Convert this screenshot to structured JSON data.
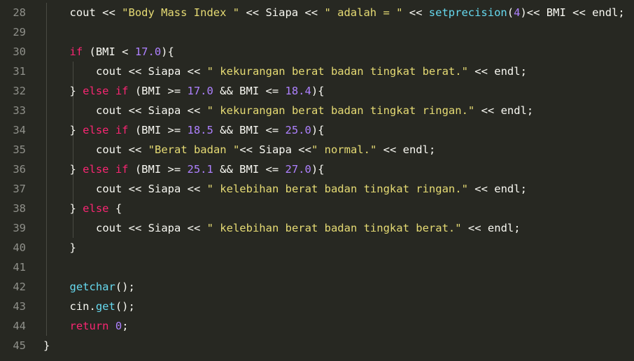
{
  "editor": {
    "theme_colors": {
      "background": "#272822",
      "line_number": "#8f908a",
      "plain": "#f8f8f2",
      "keyword": "#f92672",
      "string": "#e6db74",
      "number": "#ae81ff",
      "function": "#66d9ef"
    },
    "lines": [
      {
        "num": "28",
        "indent": 1,
        "tokens": [
          [
            "plain",
            "cout << "
          ],
          [
            "str",
            "\"Body Mass Index \""
          ],
          [
            "plain",
            " << Siapa << "
          ],
          [
            "str",
            "\" adalah = \""
          ],
          [
            "plain",
            " << "
          ],
          [
            "fn",
            "setprecision"
          ],
          [
            "plain",
            "("
          ],
          [
            "num",
            "4"
          ],
          [
            "plain",
            ")<< BMI << endl;"
          ]
        ]
      },
      {
        "num": "29",
        "indent": 0,
        "tokens": []
      },
      {
        "num": "30",
        "indent": 1,
        "tokens": [
          [
            "kw",
            "if"
          ],
          [
            "plain",
            " (BMI < "
          ],
          [
            "num",
            "17.0"
          ],
          [
            "plain",
            "){"
          ]
        ]
      },
      {
        "num": "31",
        "indent": 2,
        "tokens": [
          [
            "plain",
            "cout << Siapa << "
          ],
          [
            "str",
            "\" kekurangan berat badan tingkat berat.\""
          ],
          [
            "plain",
            " << endl;"
          ]
        ]
      },
      {
        "num": "32",
        "indent": 1,
        "tokens": [
          [
            "plain",
            "} "
          ],
          [
            "kw",
            "else if"
          ],
          [
            "plain",
            " (BMI >= "
          ],
          [
            "num",
            "17.0"
          ],
          [
            "plain",
            " && BMI <= "
          ],
          [
            "num",
            "18.4"
          ],
          [
            "plain",
            "){"
          ]
        ]
      },
      {
        "num": "33",
        "indent": 2,
        "tokens": [
          [
            "plain",
            "cout << Siapa << "
          ],
          [
            "str",
            "\" kekurangan berat badan tingkat ringan.\""
          ],
          [
            "plain",
            " << endl;"
          ]
        ]
      },
      {
        "num": "34",
        "indent": 1,
        "tokens": [
          [
            "plain",
            "} "
          ],
          [
            "kw",
            "else if"
          ],
          [
            "plain",
            " (BMI >= "
          ],
          [
            "num",
            "18.5"
          ],
          [
            "plain",
            " && BMI <= "
          ],
          [
            "num",
            "25.0"
          ],
          [
            "plain",
            "){"
          ]
        ]
      },
      {
        "num": "35",
        "indent": 2,
        "tokens": [
          [
            "plain",
            "cout << "
          ],
          [
            "str",
            "\"Berat badan \""
          ],
          [
            "plain",
            "<< Siapa <<"
          ],
          [
            "str",
            "\" normal.\""
          ],
          [
            "plain",
            " << endl;"
          ]
        ]
      },
      {
        "num": "36",
        "indent": 1,
        "tokens": [
          [
            "plain",
            "} "
          ],
          [
            "kw",
            "else if"
          ],
          [
            "plain",
            " (BMI >= "
          ],
          [
            "num",
            "25.1"
          ],
          [
            "plain",
            " && BMI <= "
          ],
          [
            "num",
            "27.0"
          ],
          [
            "plain",
            "){"
          ]
        ]
      },
      {
        "num": "37",
        "indent": 2,
        "tokens": [
          [
            "plain",
            "cout << Siapa << "
          ],
          [
            "str",
            "\" kelebihan berat badan tingkat ringan.\""
          ],
          [
            "plain",
            " << endl;"
          ]
        ]
      },
      {
        "num": "38",
        "indent": 1,
        "tokens": [
          [
            "plain",
            "} "
          ],
          [
            "kw",
            "else"
          ],
          [
            "plain",
            " {"
          ]
        ]
      },
      {
        "num": "39",
        "indent": 2,
        "tokens": [
          [
            "plain",
            "cout << Siapa << "
          ],
          [
            "str",
            "\" kelebihan berat badan tingkat berat.\""
          ],
          [
            "plain",
            " << endl;"
          ]
        ]
      },
      {
        "num": "40",
        "indent": 1,
        "tokens": [
          [
            "plain",
            "}"
          ]
        ]
      },
      {
        "num": "41",
        "indent": 0,
        "tokens": []
      },
      {
        "num": "42",
        "indent": 1,
        "tokens": [
          [
            "fn",
            "getchar"
          ],
          [
            "plain",
            "();"
          ]
        ]
      },
      {
        "num": "43",
        "indent": 1,
        "tokens": [
          [
            "plain",
            "cin."
          ],
          [
            "fn",
            "get"
          ],
          [
            "plain",
            "();"
          ]
        ]
      },
      {
        "num": "44",
        "indent": 1,
        "tokens": [
          [
            "kw",
            "return"
          ],
          [
            "plain",
            " "
          ],
          [
            "num",
            "0"
          ],
          [
            "plain",
            ";"
          ]
        ]
      },
      {
        "num": "45",
        "indent": 0,
        "tokens": [
          [
            "plain",
            "}"
          ]
        ]
      }
    ]
  }
}
